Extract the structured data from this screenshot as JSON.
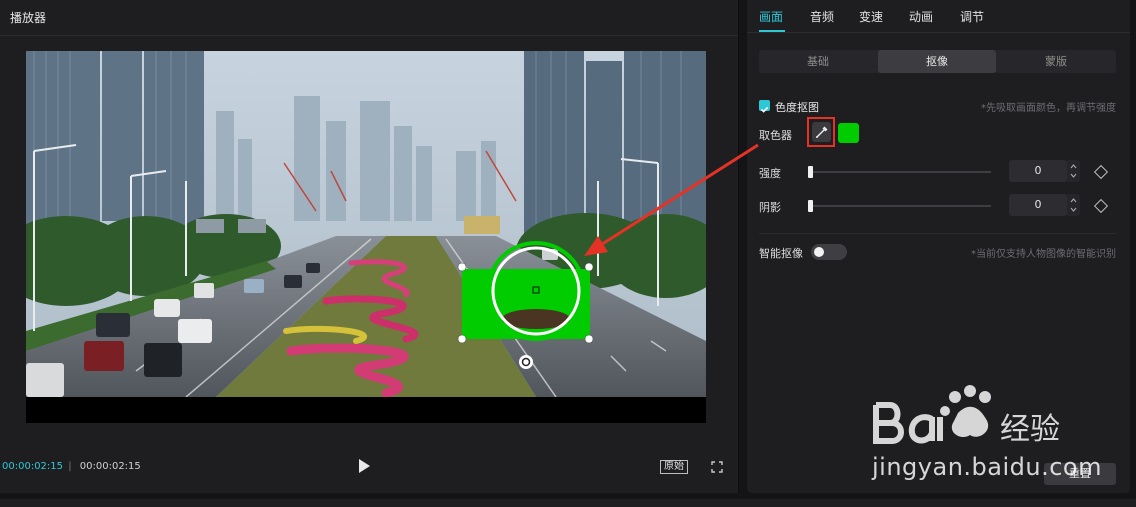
{
  "player": {
    "title": "播放器",
    "current_time": "00:00:02:15",
    "total_time": "00:00:02:15",
    "ratio_label": "原始",
    "play_icon": "play-icon",
    "fullscreen_icon": "fullscreen-icon"
  },
  "video_scene": {
    "road_sign_text": "━━━━━",
    "mask_shape": "circle",
    "mask_color": "#00cc00"
  },
  "panel": {
    "tabs": [
      {
        "label": "画面",
        "active": true
      },
      {
        "label": "音频",
        "active": false
      },
      {
        "label": "变速",
        "active": false
      },
      {
        "label": "动画",
        "active": false
      },
      {
        "label": "调节",
        "active": false
      }
    ],
    "subtabs": [
      {
        "label": "基础",
        "active": false
      },
      {
        "label": "抠像",
        "active": true
      },
      {
        "label": "蒙版",
        "active": false
      }
    ],
    "chroma_key": {
      "label": "色度抠图",
      "checked": true,
      "hint": "*先吸取画面颜色，再调节强度"
    },
    "color_picker": {
      "label": "取色器",
      "picked_color": "#00cc00",
      "icon": "eyedropper-icon"
    },
    "intensity": {
      "label": "强度",
      "value": "0"
    },
    "shadow": {
      "label": "阴影",
      "value": "0"
    },
    "smart_cutout": {
      "label": "智能抠像",
      "enabled": false,
      "hint": "*当前仅支持人物图像的智能识别"
    },
    "reset_label": "重置"
  },
  "watermark": {
    "brand": "Bai 经验",
    "url": "jingyan.baidu.com"
  },
  "colors": {
    "accent": "#2ec7d6",
    "annotation_red": "#e53226",
    "key_green": "#00cc00"
  }
}
